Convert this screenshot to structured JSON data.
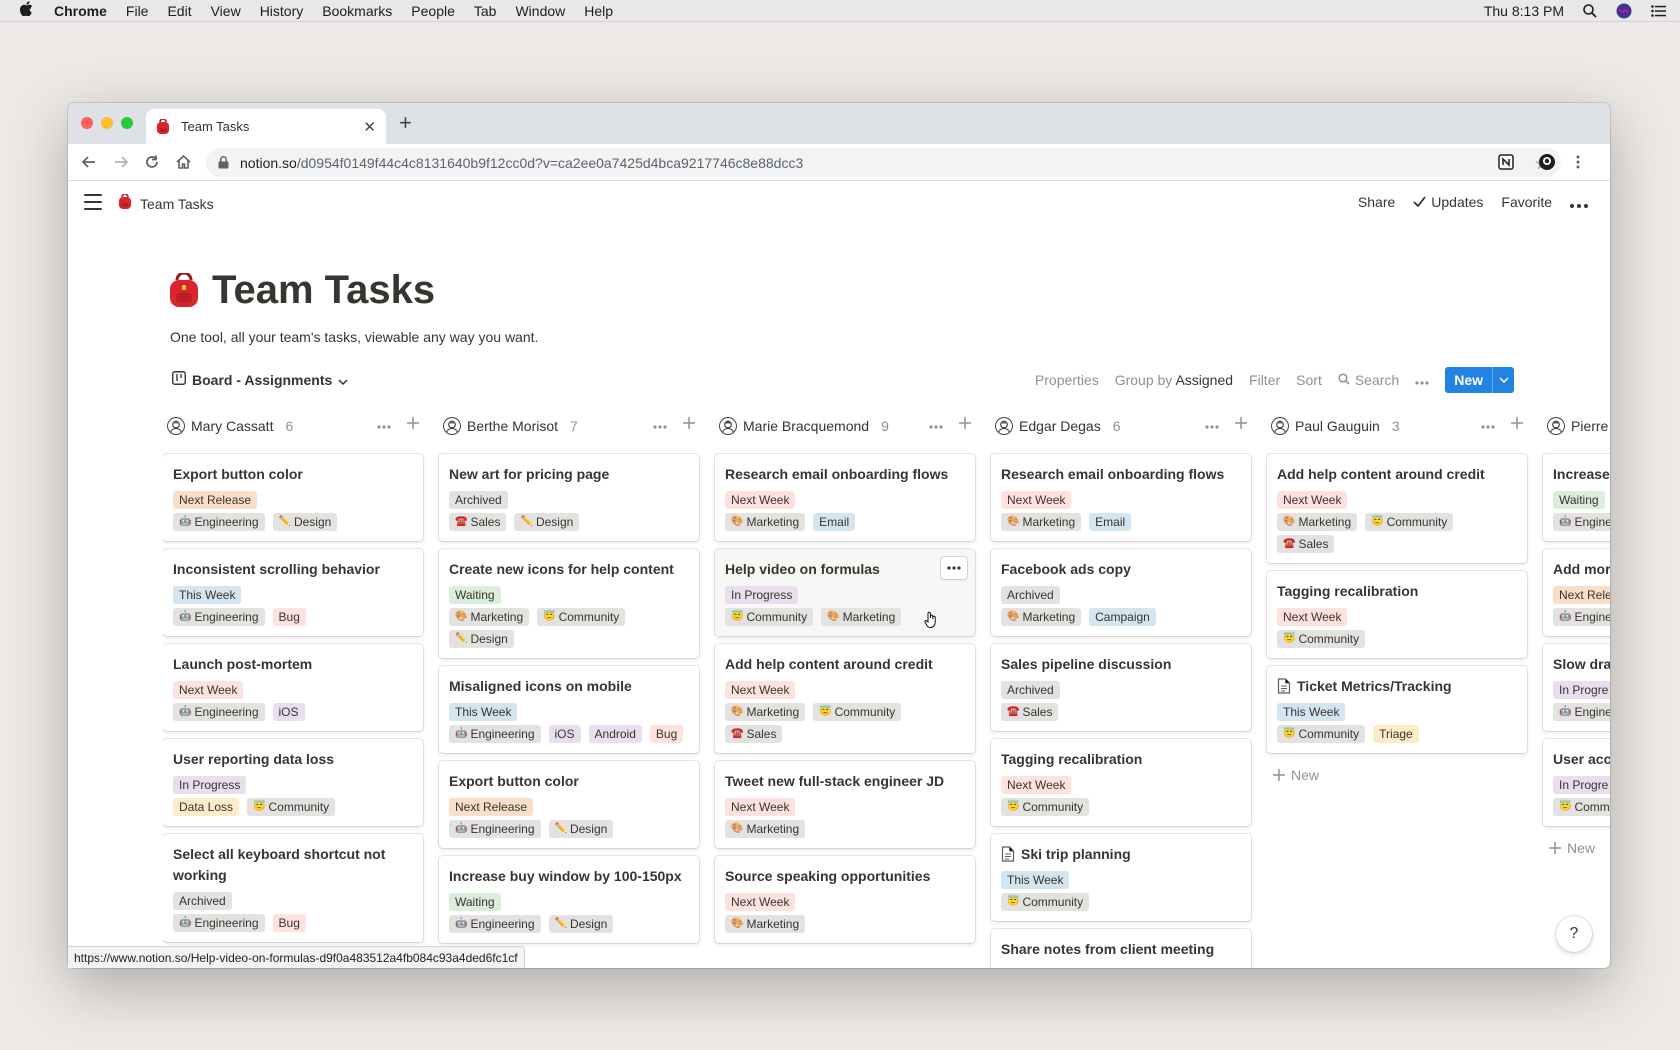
{
  "menubar": {
    "app": "Chrome",
    "items": [
      "File",
      "Edit",
      "View",
      "History",
      "Bookmarks",
      "People",
      "Tab",
      "Window",
      "Help"
    ],
    "clock": "Thu 8:13 PM"
  },
  "browser": {
    "tab_title": "Team Tasks",
    "url_host": "notion.so",
    "url_path": "/d0954f0149f44c4c8131640b9f12cc0d?v=ca2ee0a7425d4bca9217746c8e88dcc3",
    "status_url": "https://www.notion.so/Help-video-on-formulas-d9f0a483512a4fb084c93a4ded6fc1cf"
  },
  "topbar": {
    "breadcrumb": "Team Tasks",
    "share": "Share",
    "updates": "Updates",
    "favorite": "Favorite"
  },
  "page": {
    "title": "Team Tasks",
    "description": "One tool, all your team's tasks, viewable any way you want."
  },
  "viewbar": {
    "view_name": "Board - Assignments",
    "properties": "Properties",
    "group_by_prefix": "Group by",
    "group_by_value": "Assigned",
    "filter": "Filter",
    "sort": "Sort",
    "search": "Search",
    "new": "New"
  },
  "board": {
    "new_label": "New",
    "columns": [
      {
        "name": "Mary Cassatt",
        "count": "6",
        "cards": [
          {
            "title": "Export button color",
            "rows": [
              [
                {
                  "t": "Next Release",
                  "c": "orange"
                }
              ],
              [
                {
                  "t": "Engineering",
                  "c": "gray",
                  "e": "🤖"
                },
                {
                  "t": "Design",
                  "c": "gray",
                  "e": "✏️"
                }
              ]
            ]
          },
          {
            "title": "Inconsistent scrolling behavior",
            "rows": [
              [
                {
                  "t": "This Week",
                  "c": "blue"
                }
              ],
              [
                {
                  "t": "Engineering",
                  "c": "gray",
                  "e": "🤖"
                },
                {
                  "t": "Bug",
                  "c": "red"
                }
              ]
            ]
          },
          {
            "title": "Launch post-mortem",
            "rows": [
              [
                {
                  "t": "Next Week",
                  "c": "red"
                }
              ],
              [
                {
                  "t": "Engineering",
                  "c": "gray",
                  "e": "🤖"
                },
                {
                  "t": "iOS",
                  "c": "purple"
                }
              ]
            ]
          },
          {
            "title": "User reporting data loss",
            "rows": [
              [
                {
                  "t": "In Progress",
                  "c": "purple"
                }
              ],
              [
                {
                  "t": "Data Loss",
                  "c": "yellow"
                },
                {
                  "t": "Community",
                  "c": "gray",
                  "e": "😇"
                }
              ]
            ]
          },
          {
            "title": "Select all keyboard shortcut not working",
            "rows": [
              [
                {
                  "t": "Archived",
                  "c": "gray"
                }
              ],
              [
                {
                  "t": "Engineering",
                  "c": "gray",
                  "e": "🤖"
                },
                {
                  "t": "Bug",
                  "c": "red"
                }
              ]
            ]
          }
        ]
      },
      {
        "name": "Berthe Morisot",
        "count": "7",
        "cards": [
          {
            "title": "New art for pricing page",
            "rows": [
              [
                {
                  "t": "Archived",
                  "c": "gray"
                }
              ],
              [
                {
                  "t": "Sales",
                  "c": "gray",
                  "e": "☎️"
                },
                {
                  "t": "Design",
                  "c": "gray",
                  "e": "✏️"
                }
              ]
            ]
          },
          {
            "title": "Create new icons for help content",
            "rows": [
              [
                {
                  "t": "Waiting",
                  "c": "green"
                }
              ],
              [
                {
                  "t": "Marketing",
                  "c": "gray",
                  "e": "🎨"
                },
                {
                  "t": "Community",
                  "c": "gray",
                  "e": "😇"
                }
              ],
              [
                {
                  "t": "Design",
                  "c": "gray",
                  "e": "✏️"
                }
              ]
            ]
          },
          {
            "title": "Misaligned icons on mobile",
            "rows": [
              [
                {
                  "t": "This Week",
                  "c": "blue"
                }
              ],
              [
                {
                  "t": "Engineering",
                  "c": "gray",
                  "e": "🤖"
                },
                {
                  "t": "iOS",
                  "c": "purple"
                },
                {
                  "t": "Android",
                  "c": "purple"
                },
                {
                  "t": "Bug",
                  "c": "red"
                }
              ]
            ]
          },
          {
            "title": "Export button color",
            "rows": [
              [
                {
                  "t": "Next Release",
                  "c": "orange"
                }
              ],
              [
                {
                  "t": "Engineering",
                  "c": "gray",
                  "e": "🤖"
                },
                {
                  "t": "Design",
                  "c": "gray",
                  "e": "✏️"
                }
              ]
            ]
          },
          {
            "title": "Increase buy window by 100-150px",
            "rows": [
              [
                {
                  "t": "Waiting",
                  "c": "green"
                }
              ],
              [
                {
                  "t": "Engineering",
                  "c": "gray",
                  "e": "🤖"
                },
                {
                  "t": "Design",
                  "c": "gray",
                  "e": "✏️"
                }
              ]
            ]
          }
        ]
      },
      {
        "name": "Marie Bracquemond",
        "count": "9",
        "cards": [
          {
            "title": "Research email onboarding flows",
            "rows": [
              [
                {
                  "t": "Next Week",
                  "c": "red"
                }
              ],
              [
                {
                  "t": "Marketing",
                  "c": "gray",
                  "e": "🎨"
                },
                {
                  "t": "Email",
                  "c": "blue"
                }
              ]
            ]
          },
          {
            "title": "Help video on formulas",
            "hover": true,
            "rows": [
              [
                {
                  "t": "In Progress",
                  "c": "purple"
                }
              ],
              [
                {
                  "t": "Community",
                  "c": "gray",
                  "e": "😇"
                },
                {
                  "t": "Marketing",
                  "c": "gray",
                  "e": "🎨"
                }
              ]
            ]
          },
          {
            "title": "Add help content around credit",
            "rows": [
              [
                {
                  "t": "Next Week",
                  "c": "red"
                }
              ],
              [
                {
                  "t": "Marketing",
                  "c": "gray",
                  "e": "🎨"
                },
                {
                  "t": "Community",
                  "c": "gray",
                  "e": "😇"
                }
              ],
              [
                {
                  "t": "Sales",
                  "c": "gray",
                  "e": "☎️"
                }
              ]
            ]
          },
          {
            "title": "Tweet new full-stack engineer JD",
            "rows": [
              [
                {
                  "t": "Next Week",
                  "c": "red"
                }
              ],
              [
                {
                  "t": "Marketing",
                  "c": "gray",
                  "e": "🎨"
                }
              ]
            ]
          },
          {
            "title": "Source speaking opportunities",
            "rows": [
              [
                {
                  "t": "Next Week",
                  "c": "red"
                }
              ],
              [
                {
                  "t": "Marketing",
                  "c": "gray",
                  "e": "🎨"
                }
              ]
            ]
          }
        ]
      },
      {
        "name": "Edgar Degas",
        "count": "6",
        "cards": [
          {
            "title": "Research email onboarding flows",
            "rows": [
              [
                {
                  "t": "Next Week",
                  "c": "red"
                }
              ],
              [
                {
                  "t": "Marketing",
                  "c": "gray",
                  "e": "🎨"
                },
                {
                  "t": "Email",
                  "c": "blue"
                }
              ]
            ]
          },
          {
            "title": "Facebook ads copy",
            "rows": [
              [
                {
                  "t": "Archived",
                  "c": "gray"
                }
              ],
              [
                {
                  "t": "Marketing",
                  "c": "gray",
                  "e": "🎨"
                },
                {
                  "t": "Campaign",
                  "c": "blue"
                }
              ]
            ]
          },
          {
            "title": "Sales pipeline discussion",
            "rows": [
              [
                {
                  "t": "Archived",
                  "c": "gray"
                }
              ],
              [
                {
                  "t": "Sales",
                  "c": "gray",
                  "e": "☎️"
                }
              ]
            ]
          },
          {
            "title": "Tagging recalibration",
            "rows": [
              [
                {
                  "t": "Next Week",
                  "c": "red"
                }
              ],
              [
                {
                  "t": "Community",
                  "c": "gray",
                  "e": "😇"
                }
              ]
            ]
          },
          {
            "title": "Ski trip planning",
            "doc": true,
            "rows": [
              [
                {
                  "t": "This Week",
                  "c": "blue"
                }
              ],
              [
                {
                  "t": "Community",
                  "c": "gray",
                  "e": "😇"
                }
              ]
            ]
          },
          {
            "title": "Share notes from client meeting",
            "rows": []
          }
        ]
      },
      {
        "name": "Paul Gauguin",
        "count": "3",
        "show_new": true,
        "cards": [
          {
            "title": "Add help content around credit",
            "rows": [
              [
                {
                  "t": "Next Week",
                  "c": "red"
                }
              ],
              [
                {
                  "t": "Marketing",
                  "c": "gray",
                  "e": "🎨"
                },
                {
                  "t": "Community",
                  "c": "gray",
                  "e": "😇"
                }
              ],
              [
                {
                  "t": "Sales",
                  "c": "gray",
                  "e": "☎️"
                }
              ]
            ]
          },
          {
            "title": "Tagging recalibration",
            "rows": [
              [
                {
                  "t": "Next Week",
                  "c": "red"
                }
              ],
              [
                {
                  "t": "Community",
                  "c": "gray",
                  "e": "😇"
                }
              ]
            ]
          },
          {
            "title": "Ticket Metrics/Tracking",
            "doc": true,
            "rows": [
              [
                {
                  "t": "This Week",
                  "c": "blue"
                }
              ],
              [
                {
                  "t": "Community",
                  "c": "gray",
                  "e": "😇"
                },
                {
                  "t": "Triage",
                  "c": "yellow"
                }
              ]
            ]
          }
        ]
      },
      {
        "name": "Pierre",
        "count": "",
        "show_new": true,
        "cards": [
          {
            "title": "Increase",
            "rows": [
              [
                {
                  "t": "Waiting",
                  "c": "green"
                }
              ],
              [
                {
                  "t": "Engine",
                  "c": "gray",
                  "e": "🤖"
                }
              ]
            ]
          },
          {
            "title": "Add more",
            "rows": [
              [
                {
                  "t": "Next Rele",
                  "c": "orange"
                }
              ],
              [
                {
                  "t": "Engine",
                  "c": "gray",
                  "e": "🤖"
                }
              ]
            ]
          },
          {
            "title": "Slow dra",
            "rows": [
              [
                {
                  "t": "In Progre",
                  "c": "purple"
                }
              ],
              [
                {
                  "t": "Engine",
                  "c": "gray",
                  "e": "🤖"
                }
              ]
            ]
          },
          {
            "title": "User acc",
            "rows": [
              [
                {
                  "t": "In Progre",
                  "c": "purple"
                }
              ],
              [
                {
                  "t": "Comm",
                  "c": "gray",
                  "e": "😇"
                }
              ]
            ]
          }
        ]
      }
    ]
  }
}
